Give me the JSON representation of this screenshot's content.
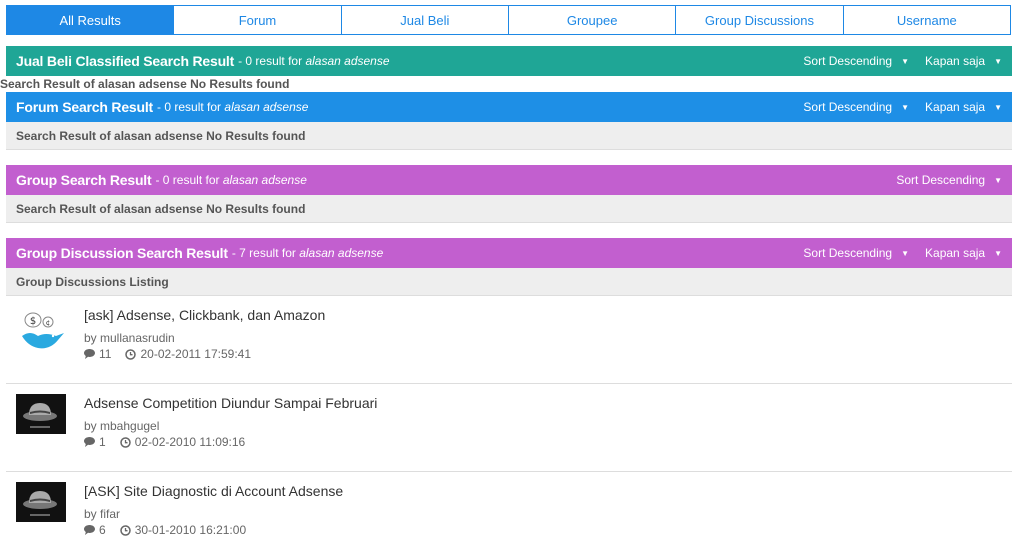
{
  "tabs": [
    "All Results",
    "Forum",
    "Jual Beli",
    "Groupee",
    "Group Discussions",
    "Username"
  ],
  "sections": {
    "jual_beli": {
      "title": "Jual Beli Classified Search Result",
      "count_text": "- 0 result for",
      "query": "alasan adsense",
      "sort_label": "Sort Descending",
      "time_label": "Kapan saja",
      "body": "Search Result of alasan adsense No Results found"
    },
    "forum": {
      "title": "Forum Search Result",
      "count_text": "- 0 result for",
      "query": "alasan adsense",
      "sort_label": "Sort Descending",
      "time_label": "Kapan saja",
      "body": "Search Result of alasan adsense No Results found"
    },
    "group": {
      "title": "Group Search Result",
      "count_text": "- 0 result for",
      "query": "alasan adsense",
      "sort_label": "Sort Descending",
      "body": "Search Result of alasan adsense No Results found"
    },
    "group_discussion": {
      "title": "Group Discussion Search Result",
      "count_text": "- 7 result for",
      "query": "alasan adsense",
      "sort_label": "Sort Descending",
      "time_label": "Kapan saja",
      "body": "Group Discussions Listing"
    }
  },
  "discussions": [
    {
      "title": "[ask] Adsense, Clickbank, dan Amazon",
      "by": "by mullanasrudin",
      "replies": "11",
      "date": "20-02-2011 17:59:41",
      "avatar": "bird-money-avatar"
    },
    {
      "title": "Adsense Competition Diundur Sampai Februari",
      "by": "by mbahgugel",
      "replies": "1",
      "date": "02-02-2010 11:09:16",
      "avatar": "hat-avatar"
    },
    {
      "title": "[ASK] Site Diagnostic di Account Adsense",
      "by": "by fifar",
      "replies": "6",
      "date": "30-01-2010 16:21:00",
      "avatar": "hat-avatar"
    }
  ],
  "colors": {
    "tab_blue": "#1e88e5",
    "teal": "#1fa696",
    "blue": "#1e8fe6",
    "purple": "#c25fcf"
  }
}
